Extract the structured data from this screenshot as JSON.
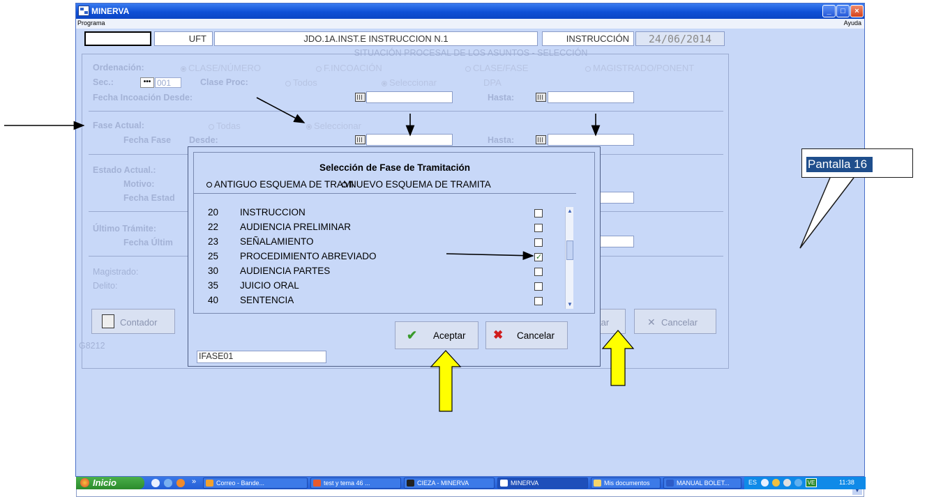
{
  "window": {
    "title": "MINERVA",
    "menu_left": "Programa",
    "menu_right": "Ayuda",
    "btn_min": "_",
    "btn_max": "□",
    "btn_close": "×"
  },
  "header": {
    "field1": "",
    "uft": "UFT",
    "court": "JDO.1A.INST.E INSTRUCCION N.1",
    "section": "INSTRUCCIÓN",
    "date": "24/06/2014",
    "subtitle": "SITUACIÓN PROCESAL DE LOS ASUNTOS - SELECCIÓN"
  },
  "form": {
    "ordenacion_label": "Ordenación:",
    "ordenacion_options": [
      "CLASE/NÚMERO",
      "F.INCOACIÓN",
      "CLASE/FASE",
      "MAGISTRADO/PONENT"
    ],
    "sec_label": "Sec.:",
    "sec_button": "•••",
    "sec_value": "001",
    "clase_proc_label": "Clase Proc:",
    "clase_proc_options": [
      "Todos",
      "Seleccionar",
      "DPA"
    ],
    "fecha_incoacion_label": "Fecha Incoación Desde:",
    "hasta_label": "Hasta:",
    "fase_actual_label": "Fase Actual:",
    "fase_options": [
      "Todas",
      "Seleccionar"
    ],
    "fecha_fase_label": "Fecha Fase",
    "desde_label": "Desde:",
    "estado_actual_label": "Estado Actual.:",
    "motivo_label": "Motivo:",
    "fecha_estado_label": "Fecha Estad",
    "ultimo_tramite_label": "Último Trámite:",
    "fecha_ultimo_label": "Fecha Últim",
    "magistrado_label": "Magistrado:",
    "delito_label": "Delito:",
    "contador_button": "Contador",
    "aceptar_button_partial": "tar",
    "cancelar_button": "Cancelar",
    "form_code": "G8212"
  },
  "dialog": {
    "title": "Selección de Fase de Tramitación",
    "radio_old": "ANTIGUO ESQUEMA DE TRAMI",
    "radio_new": "NUEVO ESQUEMA DE TRAMITA",
    "items": [
      {
        "code": "20",
        "label": "INSTRUCCION",
        "checked": false
      },
      {
        "code": "22",
        "label": "AUDIENCIA PRELIMINAR",
        "checked": false
      },
      {
        "code": "23",
        "label": "SEÑALAMIENTO",
        "checked": false
      },
      {
        "code": "25",
        "label": "PROCEDIMIENTO ABREVIADO",
        "checked": true
      },
      {
        "code": "30",
        "label": "AUDIENCIA PARTES",
        "checked": false
      },
      {
        "code": "35",
        "label": "JUICIO ORAL",
        "checked": false
      },
      {
        "code": "40",
        "label": "SENTENCIA",
        "checked": false
      }
    ],
    "accept_button": "Aceptar",
    "cancel_button": "Cancelar",
    "form_id": "IFASE01"
  },
  "taskbar": {
    "start": "Inicio",
    "items": [
      "Correo - Bande...",
      "test y tema 46 ...",
      "CIEZA - MINERVA",
      "MINERVA",
      "Mis documentos",
      "MANUAL BOLET..."
    ],
    "tray_lang": "ES",
    "clock": "11:38"
  },
  "annotation": {
    "callout": "Pantalla 16"
  },
  "colors": {
    "window_bg": "#c8d8f8",
    "title_bar": "#0f50d6",
    "annotation_arrow": "#ffff00",
    "callout_label_bg": "#1f4e8c"
  }
}
